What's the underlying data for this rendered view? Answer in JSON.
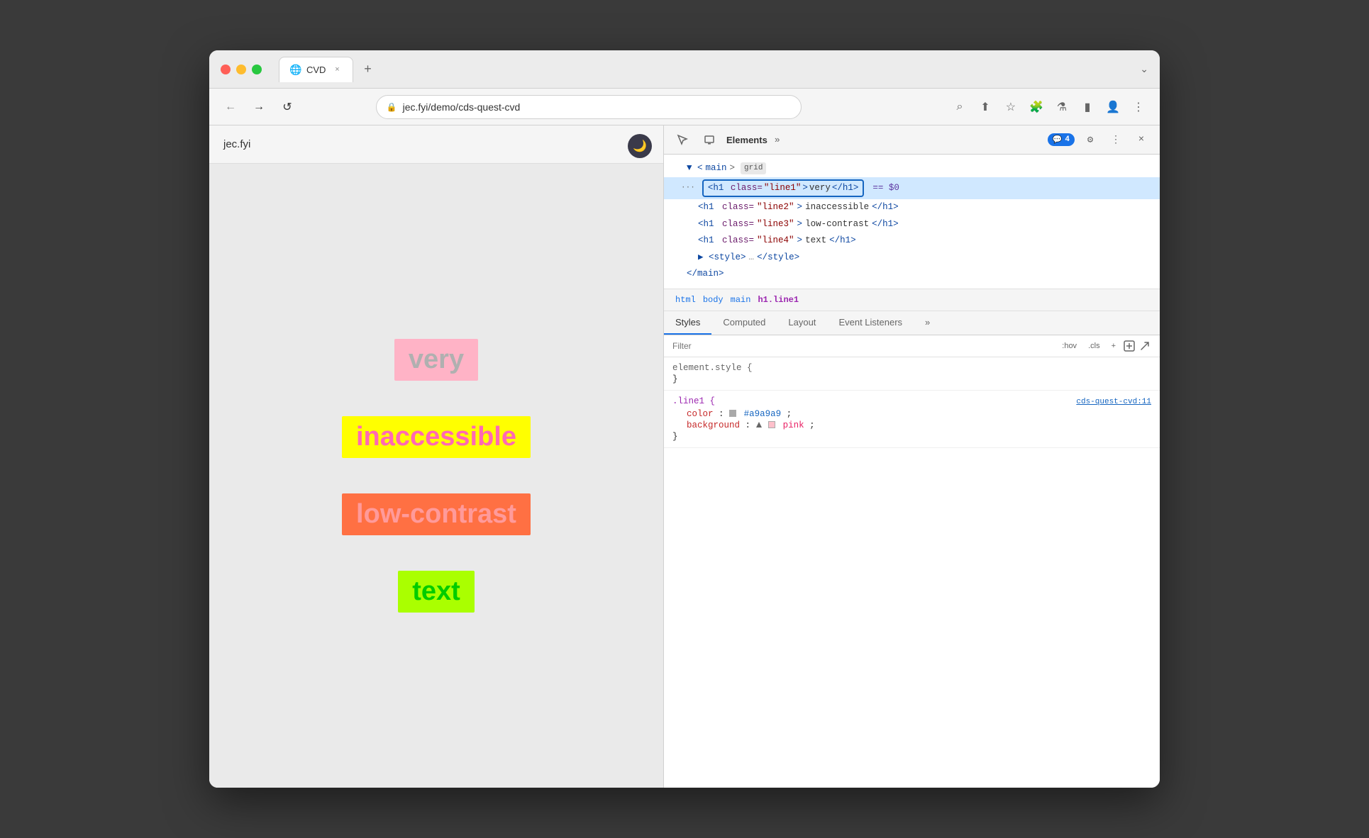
{
  "window": {
    "title": "CVD"
  },
  "browser": {
    "tab_label": "CVD",
    "tab_favicon": "🌐",
    "url": "jec.fyi/demo/cds-quest-cvd",
    "close_symbol": "×",
    "new_tab_symbol": "+",
    "chevron": "⌄"
  },
  "nav": {
    "back": "←",
    "forward": "→",
    "reload": "↺",
    "lock": "🔒"
  },
  "toolbar": {
    "search": "⌕",
    "share": "⬆",
    "star": "☆",
    "extensions": "🧩",
    "lab": "⚗",
    "sidebar": "▮",
    "profile": "👤",
    "menu": "⋮"
  },
  "page": {
    "site_name": "jec.fyi",
    "words": [
      {
        "text": "very",
        "bg": "#ffb3c6",
        "color": "#a9a9a9"
      },
      {
        "text": "inaccessible",
        "bg": "#ffff00",
        "color": "#ff69b4"
      },
      {
        "text": "low-contrast",
        "bg": "#ff7043",
        "color": "#ffaaaa"
      },
      {
        "text": "text",
        "bg": "#aaff00",
        "color": "#33cc33"
      }
    ]
  },
  "devtools": {
    "toolbar": {
      "inspect_icon": "↖",
      "device_icon": "⬜",
      "elements_tab": "Elements",
      "more_tabs": "»",
      "badge_count": "4",
      "settings_icon": "⚙",
      "more_icon": "⋮",
      "close_icon": "×"
    },
    "dom": {
      "lines": [
        {
          "indent": 0,
          "content": "▼ <main> grid",
          "type": "tag"
        },
        {
          "indent": 1,
          "content": "<h1 class=\"line1\">very</h1>",
          "type": "selected",
          "suffix": "== $0"
        },
        {
          "indent": 1,
          "content": "<h1 class=\"line2\">inaccessible</h1>",
          "type": "tag"
        },
        {
          "indent": 1,
          "content": "<h1 class=\"line3\">low-contrast</h1>",
          "type": "tag"
        },
        {
          "indent": 1,
          "content": "<h1 class=\"line4\">text</h1>",
          "type": "tag"
        },
        {
          "indent": 1,
          "content": "▶ <style>…</style>",
          "type": "tag"
        },
        {
          "indent": 0,
          "content": "</main>",
          "type": "tag"
        }
      ]
    },
    "breadcrumb": {
      "items": [
        "html",
        "body",
        "main",
        "h1.line1"
      ]
    },
    "tabs": [
      "Styles",
      "Computed",
      "Layout",
      "Event Listeners",
      "»"
    ],
    "filter": {
      "placeholder": "Filter",
      "hov_label": ":hov",
      "cls_label": ".cls"
    },
    "styles": {
      "rule1": {
        "selector": "element.style {",
        "close": "}",
        "properties": []
      },
      "rule2": {
        "selector": ".line1 {",
        "source": "cds-quest-cvd:11",
        "close": "}",
        "properties": [
          {
            "name": "color",
            "value": "#a9a9a9",
            "swatch_color": "#a9a9a9",
            "swatch_type": "box"
          },
          {
            "name": "background",
            "value": "pink",
            "swatch_color": "#ffc0cb",
            "swatch_type": "triangle"
          }
        ]
      }
    }
  }
}
